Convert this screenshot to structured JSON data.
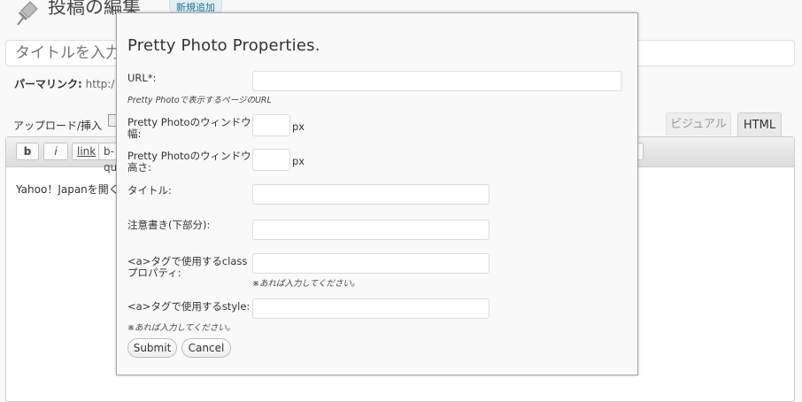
{
  "header": {
    "page_title": "投稿の編集",
    "add_new_label": "新規追加"
  },
  "post": {
    "title_placeholder": "タイトルを入力してください",
    "permalink_label": "パーマリンク:",
    "permalink_value": "http:/",
    "upload_label": "アップロード/挿入"
  },
  "editor": {
    "tab_visual": "ビジュアル",
    "tab_html": "HTML",
    "quicktags": [
      "b",
      "i",
      "link",
      "b-quote"
    ],
    "content": "Yahoo！Japanを開く"
  },
  "dialog": {
    "title": "Pretty Photo Properties.",
    "url_label": "URL*:",
    "url_note": "Pretty Photoで表示するページのURL",
    "width_label": "Pretty Photoのウィンドウ幅:",
    "height_label": "Pretty Photoのウィンドウ高さ:",
    "px_unit": "px",
    "title_label": "タイトル:",
    "note_label": "注意書き(下部分):",
    "class_label": "<a>タグで使用するclassプロパティ:",
    "class_note": "※あれば入力してください。",
    "style_label": "<a>タグで使用するstyle:",
    "style_note": "※あれば入力してください。",
    "submit_label": "Submit",
    "cancel_label": "Cancel"
  }
}
